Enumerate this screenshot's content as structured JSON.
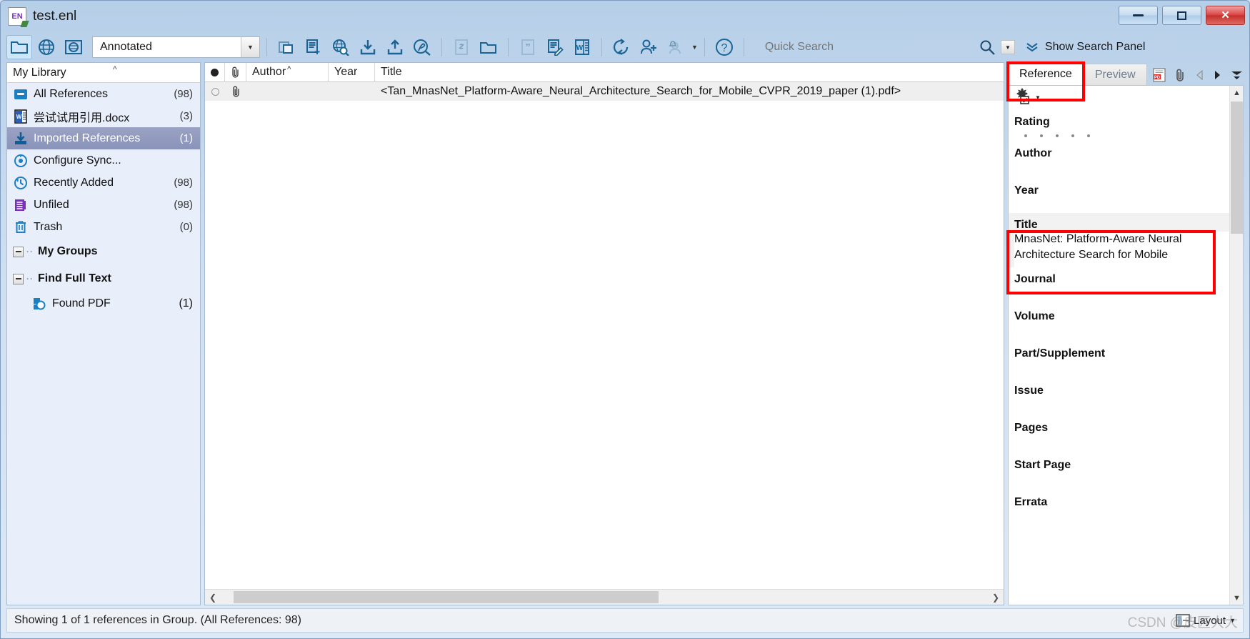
{
  "window": {
    "title": "test.enl",
    "app_icon": "EN",
    "controls": {
      "minimize": "minimize-icon",
      "maximize": "maximize-icon",
      "close": "close-icon"
    }
  },
  "toolbar": {
    "style_combo_value": "Annotated",
    "quick_search_placeholder": "Quick Search",
    "show_search_panel_label": "Show Search Panel",
    "buttons": [
      {
        "name": "local-library-button",
        "icon": "folder-icon"
      },
      {
        "name": "online-search-button",
        "icon": "globe-icon"
      },
      {
        "name": "integrated-library-button",
        "icon": "globe-folder-icon"
      },
      {
        "name": "copy-references-button",
        "icon": "copy-icon"
      },
      {
        "name": "new-reference-button",
        "icon": "new-document-icon"
      },
      {
        "name": "online-search-find-button",
        "icon": "globe-search-icon"
      },
      {
        "name": "import-button",
        "icon": "download-icon"
      },
      {
        "name": "export-button",
        "icon": "upload-icon"
      },
      {
        "name": "find-full-text-button",
        "icon": "pdf-search-icon"
      },
      {
        "name": "open-link-button",
        "icon": "link-icon"
      },
      {
        "name": "open-file-button",
        "icon": "open-folder-icon"
      },
      {
        "name": "insert-citation-button",
        "icon": "quote-icon"
      },
      {
        "name": "format-bibliography-button",
        "icon": "edit-document-icon"
      },
      {
        "name": "cite-while-you-write-button",
        "icon": "word-icon"
      },
      {
        "name": "sync-button",
        "icon": "sync-icon"
      },
      {
        "name": "share-library-button",
        "icon": "add-user-icon"
      },
      {
        "name": "activity-feed-button",
        "icon": "user-bell-icon"
      },
      {
        "name": "help-button",
        "icon": "help-icon"
      }
    ]
  },
  "sidebar": {
    "header": "My Library",
    "items": [
      {
        "label": "All References",
        "count": "(98)",
        "icon": "all-references-icon",
        "selected": false
      },
      {
        "label": "尝试试用引用.docx",
        "count": "(3)",
        "icon": "word-document-icon",
        "selected": false
      },
      {
        "label": "Imported References",
        "count": "(1)",
        "icon": "imported-icon",
        "selected": true
      },
      {
        "label": "Configure Sync...",
        "count": "",
        "icon": "sync-config-icon",
        "selected": false
      },
      {
        "label": "Recently Added",
        "count": "(98)",
        "icon": "recent-icon",
        "selected": false
      },
      {
        "label": "Unfiled",
        "count": "(98)",
        "icon": "unfiled-icon",
        "selected": false
      },
      {
        "label": "Trash",
        "count": "(0)",
        "icon": "trash-icon",
        "selected": false
      }
    ],
    "groups": [
      {
        "label": "My Groups",
        "children": []
      },
      {
        "label": "Find Full Text",
        "children": [
          {
            "label": "Found PDF",
            "count": "(1)",
            "icon": "found-pdf-icon"
          }
        ]
      }
    ]
  },
  "reference_list": {
    "columns": [
      {
        "key": "read",
        "label": "",
        "icon": "read-status-icon"
      },
      {
        "key": "attachment",
        "label": "",
        "icon": "paperclip-icon"
      },
      {
        "key": "author",
        "label": "Author",
        "sorted": "ascending"
      },
      {
        "key": "year",
        "label": "Year"
      },
      {
        "key": "title",
        "label": "Title"
      }
    ],
    "rows": [
      {
        "read": "unread",
        "attachment": "paperclip-icon",
        "author": "",
        "year": "",
        "title": "<Tan_MnasNet_Platform-Aware_Neural_Architecture_Search_for_Mobile_CVPR_2019_paper (1).pdf>"
      }
    ]
  },
  "right_panel": {
    "tabs": [
      {
        "label": "Reference",
        "active": true
      },
      {
        "label": "Preview",
        "active": false
      }
    ],
    "tab_icons": [
      {
        "name": "pdf-tab-icon",
        "label": "PDF"
      },
      {
        "name": "attachment-tab-icon",
        "label": ""
      },
      {
        "name": "previous-reference-icon",
        "label": ""
      },
      {
        "name": "next-reference-icon",
        "label": ""
      },
      {
        "name": "panel-options-icon",
        "label": ""
      }
    ],
    "panel_toolbar": {
      "gear_icon": "gear-checkbox-icon",
      "expand_icon": "double-chevron-right-icon"
    },
    "fields": [
      {
        "name": "Rating",
        "value": "",
        "type": "rating",
        "rating_max": 5,
        "rating_value": 0,
        "highlight": false
      },
      {
        "name": "Author",
        "value": "",
        "type": "text",
        "highlight": false
      },
      {
        "name": "Year",
        "value": "",
        "type": "text",
        "highlight": false
      },
      {
        "name": "Title",
        "value": "MnasNet: Platform-Aware Neural Architecture Search for Mobile",
        "type": "text",
        "highlight": true
      },
      {
        "name": "Journal",
        "value": "",
        "type": "text",
        "highlight": false
      },
      {
        "name": "Volume",
        "value": "",
        "type": "text",
        "highlight": false
      },
      {
        "name": "Part/Supplement",
        "value": "",
        "type": "text",
        "highlight": false
      },
      {
        "name": "Issue",
        "value": "",
        "type": "text",
        "highlight": false
      },
      {
        "name": "Pages",
        "value": "",
        "type": "text",
        "highlight": false
      },
      {
        "name": "Start Page",
        "value": "",
        "type": "text",
        "highlight": false
      },
      {
        "name": "Errata",
        "value": "",
        "type": "text",
        "highlight": false
      }
    ]
  },
  "statusbar": {
    "text": "Showing 1 of 1 references in Group. (All References: 98)",
    "layout_label": "Layout"
  },
  "watermark": "CSDN @皮匠大大",
  "colors": {
    "accent": "#1b6496",
    "selection": "#8a93ba",
    "annotation": "#ff0000",
    "titlebar_top": "#b6cfe8",
    "sidebar_bg": "#e8eefa"
  }
}
